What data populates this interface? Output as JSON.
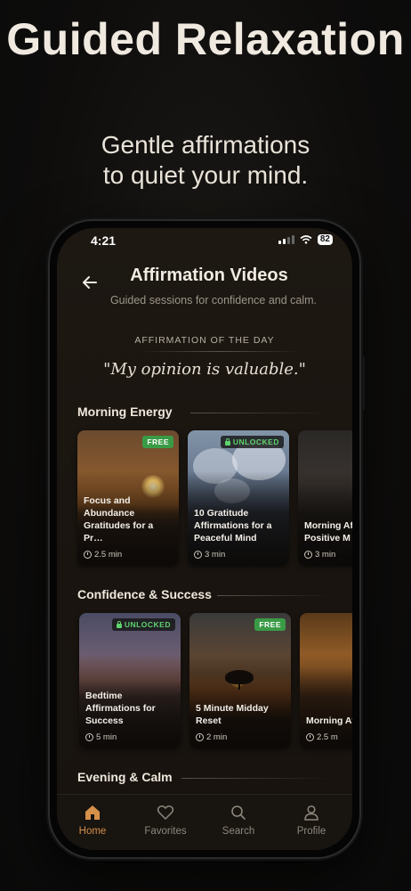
{
  "hero": {
    "title": "Guided Relaxation",
    "subtitle": "Gentle affirmations\nto quiet your mind."
  },
  "status_bar": {
    "time": "4:21",
    "battery": "82"
  },
  "header": {
    "title": "Affirmation Videos",
    "subtitle": "Guided sessions for confidence and calm."
  },
  "affirmation_of_day": {
    "label": "AFFIRMATION OF THE DAY",
    "quote": "\"My opinion is valuable.\""
  },
  "sections": [
    {
      "title": "Morning Energy",
      "cards": [
        {
          "title": "Focus and Abundance Gratitudes for a Pr…",
          "duration": "2.5 min",
          "badge": "FREE"
        },
        {
          "title": "10 Gratitude Affirmations for a Peaceful Mind",
          "duration": "3 min",
          "badge": "UNLOCKED"
        },
        {
          "title": "Morning Affirmations Positive M",
          "duration": "3 min",
          "badge": ""
        }
      ]
    },
    {
      "title": "Confidence & Success",
      "cards": [
        {
          "title": "Bedtime Affirmations for Success",
          "duration": "5 min",
          "badge": "UNLOCKED"
        },
        {
          "title": "5 Minute Midday Reset",
          "duration": "2 min",
          "badge": "FREE"
        },
        {
          "title": "Morning Affirmati Success",
          "duration": "2.5 m",
          "badge": ""
        }
      ]
    },
    {
      "title": "Evening & Calm",
      "cards": []
    }
  ],
  "bottom_nav": {
    "items": [
      {
        "label": "Home",
        "icon": "home-icon",
        "active": true
      },
      {
        "label": "Favorites",
        "icon": "heart-icon",
        "active": false
      },
      {
        "label": "Search",
        "icon": "search-icon",
        "active": false
      },
      {
        "label": "Profile",
        "icon": "person-icon",
        "active": false
      }
    ]
  },
  "colors": {
    "accent": "#d5904a",
    "free_badge": "#3a9b46",
    "unlocked_text": "#5fd36d"
  }
}
